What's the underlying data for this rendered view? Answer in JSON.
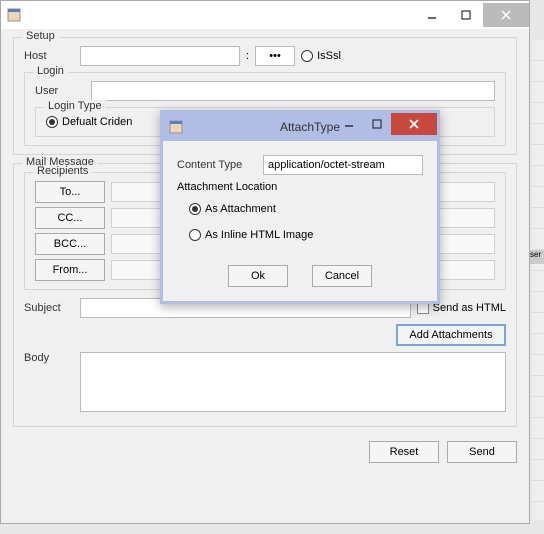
{
  "mainWindow": {
    "setup": {
      "title": "Setup",
      "hostLabel": "Host",
      "hostValue": "",
      "portValue": "•••",
      "isSslLabel": "IsSsl",
      "login": {
        "title": "Login",
        "userLabel": "User",
        "userValue": "",
        "loginTypeTitle": "Login Type",
        "defaultCredLabel": "Defualt Criden"
      }
    },
    "mail": {
      "title": "Mail Message",
      "recipientsTitle": "Recipients",
      "toLabel": "To...",
      "ccLabel": "CC...",
      "bccLabel": "BCC...",
      "fromLabel": "From...",
      "subjectLabel": "Subject",
      "subjectValue": "",
      "sendAsHtmlLabel": "Send as HTML",
      "addAttachmentsLabel": "Add Attachments",
      "bodyLabel": "Body",
      "bodyValue": ""
    },
    "resetLabel": "Reset",
    "sendLabel": "Send"
  },
  "dialog": {
    "title": "AttachType",
    "contentTypeLabel": "Content Type",
    "contentTypeValue": "application/octet-stream",
    "attachmentLocationLabel": "Attachment Location",
    "asAttachmentLabel": "As Attachment",
    "asInlineLabel": "As Inline HTML Image",
    "okLabel": "Ok",
    "cancelLabel": "Cancel"
  },
  "sideTag": "ser"
}
